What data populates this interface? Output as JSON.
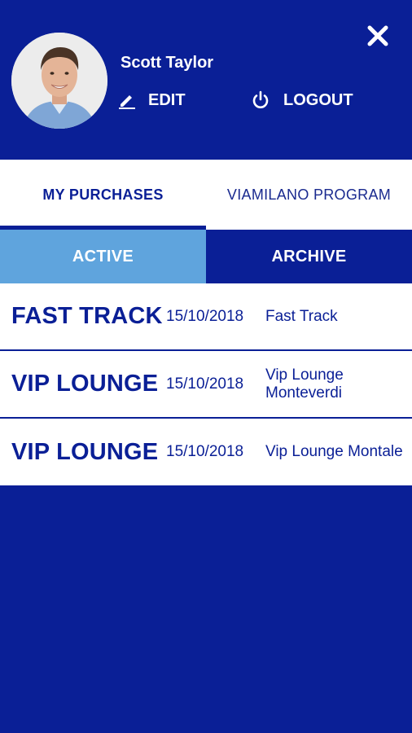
{
  "header": {
    "user_name": "Scott Taylor",
    "edit_label": "EDIT",
    "logout_label": "LOGOUT"
  },
  "tabs": [
    {
      "label": "MY PURCHASES",
      "active": true
    },
    {
      "label": "VIAMILANO PROGRAM",
      "active": false
    }
  ],
  "segments": [
    {
      "label": "ACTIVE",
      "active": true
    },
    {
      "label": "ARCHIVE",
      "active": false
    }
  ],
  "purchases": [
    {
      "title": "FAST TRACK",
      "date": "15/10/2018",
      "description": "Fast Track"
    },
    {
      "title": "VIP LOUNGE",
      "date": "15/10/2018",
      "description": "Vip Lounge Monteverdi"
    },
    {
      "title": "VIP LOUNGE",
      "date": "15/10/2018",
      "description": "Vip Lounge Montale"
    }
  ],
  "colors": {
    "primary": "#0A1F96",
    "accent": "#5FA4DD",
    "surface": "#FFFFFF"
  }
}
